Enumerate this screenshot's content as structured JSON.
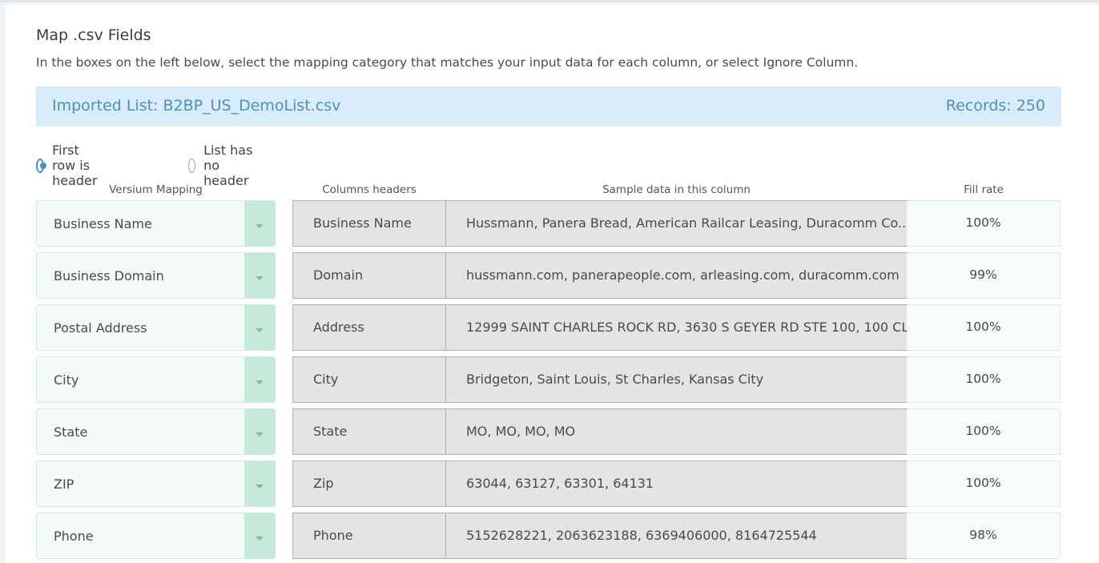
{
  "title": "Map .csv Fields",
  "description": "In the boxes on the left below, select the mapping category that matches your input data for each column, or select Ignore Column.",
  "banner": {
    "imported_list": "Imported List: B2BP_US_DemoList.csv",
    "records": "Records: 250"
  },
  "header_options": [
    {
      "label": "First row is header",
      "selected": true
    },
    {
      "label": "List has no header",
      "selected": false
    }
  ],
  "columns": {
    "mapping": "Versium Mapping",
    "headers": "Columns headers",
    "sample": "Sample data in this column",
    "fill": "Fill rate"
  },
  "rows": [
    {
      "mapping": "Business Name",
      "header": "Business Name",
      "sample": "Hussmann, Panera Bread, American Railcar Leasing, Duracomm Co...",
      "fill": "100%"
    },
    {
      "mapping": "Business Domain",
      "header": "Domain",
      "sample": "hussmann.com, panerapeople.com, arleasing.com, duracomm.com",
      "fill": "99%"
    },
    {
      "mapping": "Postal Address",
      "header": "Address",
      "sample": "12999 SAINT CHARLES ROCK RD, 3630 S GEYER RD STE 100, 100 CL...",
      "fill": "100%"
    },
    {
      "mapping": "City",
      "header": "City",
      "sample": "Bridgeton, Saint Louis, St Charles, Kansas City",
      "fill": "100%"
    },
    {
      "mapping": "State",
      "header": "State",
      "sample": "MO, MO, MO, MO",
      "fill": "100%"
    },
    {
      "mapping": "ZIP",
      "header": "Zip",
      "sample": "63044, 63127, 63301, 64131",
      "fill": "100%"
    },
    {
      "mapping": "Phone",
      "header": "Phone",
      "sample": "5152628221, 2063623188, 6369406000, 8164725544",
      "fill": "98%"
    }
  ],
  "icons": {
    "dropdown": "chevron-down-icon"
  },
  "colors": {
    "banner_bg": "#d9ecfa",
    "banner_text": "#4e90b8",
    "radio_accent": "#4b8fc1",
    "select_arrow_bg": "#c6ead9"
  }
}
